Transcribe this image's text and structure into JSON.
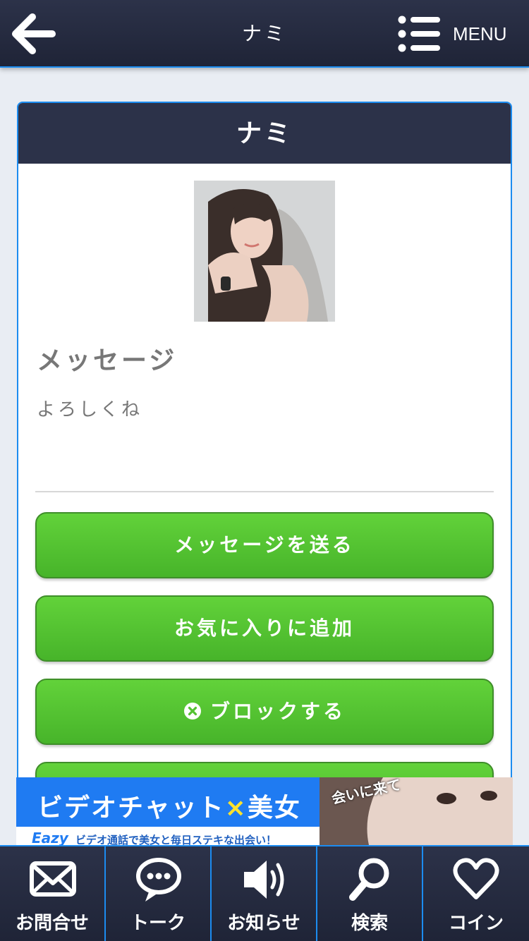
{
  "header": {
    "title": "ナミ",
    "menu_label": "MENU"
  },
  "card": {
    "title": "ナミ",
    "section_title": "メッセージ",
    "message": "よろしくね"
  },
  "buttons": {
    "send_message": "メッセージを送る",
    "add_favorite": "お気に入りに追加",
    "block": "ブロックする"
  },
  "ad": {
    "title_left": "ビデオチャット",
    "title_x": "×",
    "title_right": "美女",
    "logo": "Eazy",
    "subtitle": "ビデオ通話で美女と毎日ステキな出会い！",
    "photo_text": "会いに来て"
  },
  "tabs": [
    {
      "label": "お問合せ",
      "icon": "envelope-icon"
    },
    {
      "label": "トーク",
      "icon": "chat-bubble-icon"
    },
    {
      "label": "お知らせ",
      "icon": "speaker-icon"
    },
    {
      "label": "検索",
      "icon": "search-icon"
    },
    {
      "label": "コイン",
      "icon": "heart-icon"
    }
  ],
  "colors": {
    "header_bg": "#2c3249",
    "accent_border": "#1c8cf0",
    "button_green": "#54c232",
    "ad_blue": "#1f7bf2"
  }
}
